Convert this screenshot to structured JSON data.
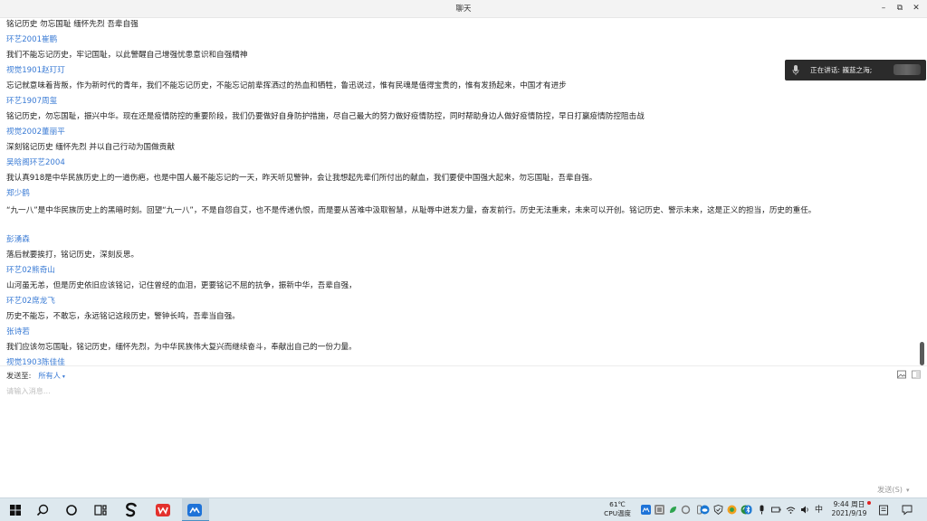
{
  "window": {
    "title": "聊天",
    "minimize": "–",
    "maximize": "⧉",
    "close": "✕"
  },
  "speaking": {
    "label": "正在讲话: 巍蓝之海;"
  },
  "messages": [
    {
      "type": "text",
      "text": "铭记历史 勿忘国耻 缅怀先烈 吾辈自强"
    },
    {
      "type": "name",
      "text": "环艺2001崔鹏"
    },
    {
      "type": "text",
      "text": "我们不能忘记历史，牢记国耻，以此警醒自己增强忧患意识和自强精神"
    },
    {
      "type": "name",
      "text": "视觉1901赵玎玎"
    },
    {
      "type": "text",
      "text": "忘记就意味着背叛，作为新时代的青年，我们不能忘记历史，不能忘记前辈挥洒过的热血和牺牲，鲁迅说过，惟有民魂是值得宝贵的，惟有发扬起来，中国才有进步"
    },
    {
      "type": "name",
      "text": "环艺1907周玺"
    },
    {
      "type": "text",
      "text": "铭记历史，勿忘国耻，振兴中华。现在还是疫情防控的重要阶段，我们仍要做好自身防护措施，尽自己最大的努力做好疫情防控，同时帮助身边人做好疫情防控，早日打赢疫情防控阻击战"
    },
    {
      "type": "name",
      "text": "视觉2002董丽平"
    },
    {
      "type": "text",
      "text": "深刻铭记历史 缅怀先烈 并以自己行动为国做贡献"
    },
    {
      "type": "name",
      "text": "吴晗阁环艺2004"
    },
    {
      "type": "text",
      "text": "我认真918是中华民族历史上的一道伤疤，也是中国人最不能忘记的一天，昨天听见警钟，会让我想起先辈们所付出的献血，我们要使中国强大起来，勿忘国耻，吾辈自强。"
    },
    {
      "type": "name",
      "text": "郑少鹤"
    },
    {
      "type": "wrap",
      "text": "“九一八”是中华民族历史上的黑暗时刻。回望“九一八”，不是自怨自艾，也不是传递仇恨，而是要从苦难中汲取智慧，从耻辱中迸发力量，奋发前行。历史无法重来，未来可以开创。铭记历史、警示未来，这是正义的担当，历史的重任。"
    },
    {
      "type": "name",
      "text": "彭湧森"
    },
    {
      "type": "text",
      "text": "落后就要挨打，铭记历史，深刻反思。"
    },
    {
      "type": "name",
      "text": "环艺02熊奇山"
    },
    {
      "type": "text",
      "text": "山河虽无恙，但是历史依旧应该铭记，记住曾经的血泪，更要铭记不屈的抗争，振新中华，吾辈自强，"
    },
    {
      "type": "name",
      "text": "环艺02席龙飞"
    },
    {
      "type": "text",
      "text": "历史不能忘，不敢忘，永远铭记这段历史，警钟长鸣，吾辈当自强。"
    },
    {
      "type": "name",
      "text": "张诗若"
    },
    {
      "type": "text",
      "text": "我们应该勿忘国耻，铭记历史，缅怀先烈，为中华民族伟大复兴而继续奋斗，奉献出自己的一份力量。"
    },
    {
      "type": "name",
      "text": "视觉1903陈佳佳"
    }
  ],
  "compose": {
    "send_to_label": "发送至:",
    "send_to_target": "所有人",
    "placeholder": "请输入消息...",
    "send_button": "发送(S)",
    "send_arrow": "▾"
  },
  "taskbar": {
    "temperature": "61℃",
    "temperature_label": "CPU温度",
    "ime": "中",
    "time": "9:44 周日",
    "date": "2021/9/19",
    "icons": [
      "windows-start-icon",
      "search-icon",
      "cortana-icon",
      "task-view-icon",
      "app-s-icon",
      "wps-icon",
      "meeting-app-icon"
    ]
  }
}
